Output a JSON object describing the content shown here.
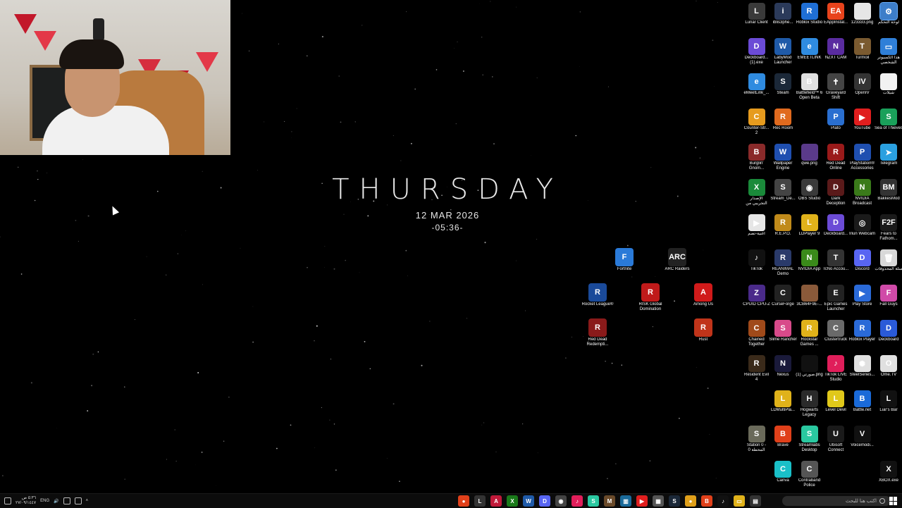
{
  "wallpaper_clock": {
    "day": "THURSDAY",
    "date": "12 MAR 2026",
    "time": "-05:36-"
  },
  "desktop_icons": [
    {
      "label": "Lunar Client",
      "icon": "lunar-client-icon",
      "color": "#3a3a3a",
      "glyph": "L"
    },
    {
      "label": "iblis3phe...",
      "icon": "image-file-icon",
      "color": "#2b3a5a",
      "glyph": "i"
    },
    {
      "label": "Roblox Studio",
      "icon": "roblox-studio-icon",
      "color": "#1f6fd6",
      "glyph": "R"
    },
    {
      "label": "EAppInstal...",
      "icon": "ea-icon",
      "color": "#e8431c",
      "glyph": "EA"
    },
    {
      "label": "123333.png",
      "icon": "image-file-icon",
      "color": "#e6e6e6",
      "glyph": ""
    },
    {
      "label": "لوحة التحكم",
      "icon": "control-panel-icon",
      "color": "#3d7ec9",
      "glyph": "⚙"
    },
    {
      "label": "Deckboard... (1).exe",
      "icon": "deckboard-icon",
      "color": "#6b4bd6",
      "glyph": "D"
    },
    {
      "label": "LabyMod Launcher",
      "icon": "labymod-icon",
      "color": "#1f5aa8",
      "glyph": "W"
    },
    {
      "label": "EMEETLINK",
      "icon": "emeetlink-icon",
      "color": "#2f8be0",
      "glyph": "e"
    },
    {
      "label": "NZXT CAM",
      "icon": "nzxt-icon",
      "color": "#5a2ca0",
      "glyph": "N"
    },
    {
      "label": "Turmoil",
      "icon": "turmoil-icon",
      "color": "#7a5a30",
      "glyph": "T"
    },
    {
      "label": "هذا الكمبيوتر الشخصي",
      "icon": "this-pc-icon",
      "color": "#2f7fd8",
      "glyph": "▭"
    },
    {
      "label": "eMeetLink_...",
      "icon": "emeetlink-icon",
      "color": "#2f8be0",
      "glyph": "e"
    },
    {
      "label": "Steam",
      "icon": "steam-icon",
      "color": "#1b2838",
      "glyph": "S"
    },
    {
      "label": "Battlefield™ 6 Open Beta",
      "icon": "battlefield-icon",
      "color": "#e0e0e0",
      "glyph": "B"
    },
    {
      "label": "Graveyard Shift",
      "icon": "graveyard-shift-icon",
      "color": "#444",
      "glyph": "✝"
    },
    {
      "label": "OpenIV",
      "icon": "openiv-icon",
      "color": "#333",
      "glyph": "IV"
    },
    {
      "label": "شيلات",
      "icon": "text-file-icon",
      "color": "#f2f2f2",
      "glyph": ""
    },
    {
      "label": "Counter-Str... 2",
      "icon": "counter-strike-icon",
      "color": "#e69b1e",
      "glyph": "C"
    },
    {
      "label": "Rec Room",
      "icon": "rec-room-icon",
      "color": "#e06a1e",
      "glyph": "R"
    },
    {
      "label": "",
      "icon": "blank-icon",
      "color": "transparent",
      "glyph": ""
    },
    {
      "label": "Plato",
      "icon": "plato-icon",
      "color": "#2a6fd0",
      "glyph": "P"
    },
    {
      "label": "YouTube",
      "icon": "youtube-icon",
      "color": "#e01e1e",
      "glyph": "▶"
    },
    {
      "label": "Sea of Thieves",
      "icon": "sea-of-thieves-icon",
      "color": "#1aa05a",
      "glyph": "S"
    },
    {
      "label": "Burglin' Gnom...",
      "icon": "burglin-gnomes-icon",
      "color": "#8a2a2a",
      "glyph": "B"
    },
    {
      "label": "Wallpaper Engine",
      "icon": "wallpaper-engine-icon",
      "color": "#1f4fb0",
      "glyph": "W"
    },
    {
      "label": "qwe.png",
      "icon": "image-file-icon",
      "color": "#5a3a8a",
      "glyph": ""
    },
    {
      "label": "Red Dead Online",
      "icon": "red-dead-online-icon",
      "color": "#9a1a1a",
      "glyph": "R"
    },
    {
      "label": "PlayStation® Accessories",
      "icon": "playstation-icon",
      "color": "#1f4fb0",
      "glyph": "P"
    },
    {
      "label": "Telegram",
      "icon": "telegram-icon",
      "color": "#2aa0e0",
      "glyph": "➤"
    },
    {
      "label": "الإصدار التجريبي من",
      "icon": "xbox-preview-icon",
      "color": "#1a8a3a",
      "glyph": "X"
    },
    {
      "label": "Stream_De...",
      "icon": "stream-deck-icon",
      "color": "#444",
      "glyph": "S"
    },
    {
      "label": "OBS Studio",
      "icon": "obs-icon",
      "color": "#3a3a3a",
      "glyph": "◉"
    },
    {
      "label": "Dark Deception",
      "icon": "dark-deception-icon",
      "color": "#5a1a1a",
      "glyph": "D"
    },
    {
      "label": "NVIDIA Broadcast",
      "icon": "nvidia-broadcast-icon",
      "color": "#3a7a1a",
      "glyph": "N"
    },
    {
      "label": "BakkesMod",
      "icon": "bakkesmod-icon",
      "color": "#333",
      "glyph": "BM"
    },
    {
      "label": "اغنية-تصم",
      "icon": "media-file-icon",
      "color": "#e6e6e6",
      "glyph": "▶"
    },
    {
      "label": "R.E.P.O.",
      "icon": "repo-icon",
      "color": "#c08a1a",
      "glyph": "R"
    },
    {
      "label": "LDPlayer 9",
      "icon": "ldplayer-icon",
      "color": "#e0b21a",
      "glyph": "L"
    },
    {
      "label": "Deckboard...",
      "icon": "deckboard-icon",
      "color": "#6b4bd6",
      "glyph": "D"
    },
    {
      "label": "Iriun Webcam",
      "icon": "iriun-webcam-icon",
      "color": "#1a1a1a",
      "glyph": "◎"
    },
    {
      "label": "Fears to Fathom...",
      "icon": "fears-to-fathom-icon",
      "color": "#1a1a1a",
      "glyph": "F2F"
    },
    {
      "label": "TikTok",
      "icon": "tiktok-icon",
      "color": "#111",
      "glyph": "♪"
    },
    {
      "label": "REANIMAL Demo",
      "icon": "reanimal-icon",
      "color": "#2a3a6a",
      "glyph": "R"
    },
    {
      "label": "NVIDIA App",
      "icon": "nvidia-icon",
      "color": "#3a8a1a",
      "glyph": "N"
    },
    {
      "label": "TcNo Accou...",
      "icon": "tcno-icon",
      "color": "#333",
      "glyph": "T"
    },
    {
      "label": "Discord",
      "icon": "discord-icon",
      "color": "#5865f2",
      "glyph": "D"
    },
    {
      "label": "سلة المحذوفات",
      "icon": "recycle-bin-icon",
      "color": "#d8d8d8",
      "glyph": "🗑"
    },
    {
      "label": "CPUID CPU-Z",
      "icon": "cpu-z-icon",
      "color": "#4a2a8a",
      "glyph": "Z"
    },
    {
      "label": "CurseForge",
      "icon": "curseforge-icon",
      "color": "#222",
      "glyph": "C"
    },
    {
      "label": "3CB64F9E-...",
      "icon": "image-file-icon",
      "color": "#8a5a3a",
      "glyph": ""
    },
    {
      "label": "Epic Games Launcher",
      "icon": "epic-games-icon",
      "color": "#222",
      "glyph": "E"
    },
    {
      "label": "Play Store",
      "icon": "play-store-icon",
      "color": "#2a6ad8",
      "glyph": "▶"
    },
    {
      "label": "Fall Guys",
      "icon": "fall-guys-icon",
      "color": "#d04aa8",
      "glyph": "F"
    },
    {
      "label": "Chained Together",
      "icon": "chained-together-icon",
      "color": "#a04a1a",
      "glyph": "C"
    },
    {
      "label": "Slime Rancher",
      "icon": "slime-rancher-icon",
      "color": "#d84a8a",
      "glyph": "S"
    },
    {
      "label": "Rockstar Games ...",
      "icon": "rockstar-icon",
      "color": "#e0b21a",
      "glyph": "R"
    },
    {
      "label": "Clustertruck",
      "icon": "clustertruck-icon",
      "color": "#6a6a6a",
      "glyph": "C"
    },
    {
      "label": "Roblox Player",
      "icon": "roblox-icon",
      "color": "#2a6ad8",
      "glyph": "R"
    },
    {
      "label": "Deckboard",
      "icon": "deckboard-icon",
      "color": "#2a5ad8",
      "glyph": "D"
    },
    {
      "label": "Resident Evil 4",
      "icon": "resident-evil-icon",
      "color": "#3a2a1a",
      "glyph": "R"
    },
    {
      "label": "Nexus",
      "icon": "nexus-icon",
      "color": "#1a1a3a",
      "glyph": "N"
    },
    {
      "label": "صورتي (1).png",
      "icon": "image-file-icon",
      "color": "#111",
      "glyph": ""
    },
    {
      "label": "TikTok LIVE Studio",
      "icon": "tiktok-live-icon",
      "color": "#e01e5a",
      "glyph": "♪"
    },
    {
      "label": "SteelSeries...",
      "icon": "steelseries-icon",
      "color": "#e0e0e0",
      "glyph": "✺"
    },
    {
      "label": "Ome.TV",
      "icon": "ome-tv-icon",
      "color": "#e0e0e0",
      "glyph": "O"
    },
    {
      "label": "",
      "icon": "blank-icon",
      "color": "transparent",
      "glyph": ""
    },
    {
      "label": "LDMultiPla...",
      "icon": "ldmultiplayer-icon",
      "color": "#e0b21a",
      "glyph": "L"
    },
    {
      "label": "Hogwarts Legacy",
      "icon": "hogwarts-legacy-icon",
      "color": "#2a2a2a",
      "glyph": "H"
    },
    {
      "label": "Level Devil",
      "icon": "level-devil-icon",
      "color": "#e0c81a",
      "glyph": "L"
    },
    {
      "label": "Battle.net",
      "icon": "battle-net-icon",
      "color": "#1a6ad8",
      "glyph": "B"
    },
    {
      "label": "Liar's Bar",
      "icon": "liars-bar-icon",
      "color": "#111",
      "glyph": "L"
    },
    {
      "label": "Station 0 - المحطة 0",
      "icon": "station-zero-icon",
      "color": "#6a6a5a",
      "glyph": "S"
    },
    {
      "label": "Brave",
      "icon": "brave-icon",
      "color": "#e0401a",
      "glyph": "B"
    },
    {
      "label": "Streamlabs Desktop",
      "icon": "streamlabs-icon",
      "color": "#2ac8a0",
      "glyph": "S"
    },
    {
      "label": "Ubisoft Connect",
      "icon": "ubisoft-icon",
      "color": "#1a1a1a",
      "glyph": "U"
    },
    {
      "label": "Voicemodi...",
      "icon": "voicemod-icon",
      "color": "#111",
      "glyph": "V"
    },
    {
      "label": "",
      "icon": "blank-icon",
      "color": "transparent",
      "glyph": ""
    },
    {
      "label": "",
      "icon": "blank-icon",
      "color": "transparent",
      "glyph": ""
    },
    {
      "label": "Canva",
      "icon": "canva-icon",
      "color": "#1ac0c8",
      "glyph": "C"
    },
    {
      "label": "Contraband Police",
      "icon": "contraband-police-icon",
      "color": "#555",
      "glyph": "C"
    },
    {
      "label": "",
      "icon": "blank-icon",
      "color": "transparent",
      "glyph": ""
    },
    {
      "label": "",
      "icon": "blank-icon",
      "color": "transparent",
      "glyph": ""
    },
    {
      "label": "XBOX.exe",
      "icon": "xbox-icon",
      "color": "#111",
      "glyph": "X"
    }
  ],
  "free_icons": [
    {
      "label": "Fortnite",
      "icon": "fortnite-icon",
      "color": "#2a7ad8",
      "glyph": "F"
    },
    {
      "label": "ARC Raiders",
      "icon": "arc-raiders-icon",
      "color": "#222",
      "glyph": "ARC"
    },
    {
      "label": "Rocket League®",
      "icon": "rocket-league-icon",
      "color": "#1a4a9a",
      "glyph": "R"
    },
    {
      "label": "RISK Global Domination",
      "icon": "risk-icon",
      "color": "#c01a1a",
      "glyph": "R"
    },
    {
      "label": "Among Us",
      "icon": "among-us-icon",
      "color": "#d01a1a",
      "glyph": "A"
    },
    {
      "label": "Red Dead Redempti...",
      "icon": "red-dead-redemption-icon",
      "color": "#8a1a1a",
      "glyph": "R"
    },
    {
      "label": "Rust",
      "icon": "rust-icon",
      "color": "#c0341a",
      "glyph": "R"
    }
  ],
  "taskbar": {
    "clock_time": "٥:٣٦ ص",
    "clock_date": "٢٧/٠٩/١٤٤٧",
    "language": "ENG",
    "search_placeholder": "اكتب هنا للبحث",
    "apps": [
      {
        "icon": "chrome-icon",
        "color": "#e0401a",
        "glyph": "●"
      },
      {
        "icon": "lunar-client-icon",
        "color": "#333",
        "glyph": "L"
      },
      {
        "icon": "adobe-icon",
        "color": "#c01a3a",
        "glyph": "A"
      },
      {
        "icon": "xbox-icon",
        "color": "#1a7a1a",
        "glyph": "X"
      },
      {
        "icon": "labymod-icon",
        "color": "#1f5aa8",
        "glyph": "W"
      },
      {
        "icon": "discord-icon",
        "color": "#5865f2",
        "glyph": "D"
      },
      {
        "icon": "obs-icon",
        "color": "#444",
        "glyph": "◉"
      },
      {
        "icon": "tiktok-live-icon",
        "color": "#e01e5a",
        "glyph": "♪"
      },
      {
        "icon": "streamlabs-icon",
        "color": "#2ac8a0",
        "glyph": "S"
      },
      {
        "icon": "minecraft-icon",
        "color": "#6a4a2a",
        "glyph": "M"
      },
      {
        "icon": "dashboard-icon",
        "color": "#1a6a9a",
        "glyph": "▥"
      },
      {
        "icon": "youtube-icon",
        "color": "#e01e1e",
        "glyph": "▶"
      },
      {
        "icon": "grid-app-icon",
        "color": "#555",
        "glyph": "▦"
      },
      {
        "icon": "steam-icon",
        "color": "#1b2838",
        "glyph": "S"
      },
      {
        "icon": "chrome-icon",
        "color": "#e0a01a",
        "glyph": "●"
      },
      {
        "icon": "brave-icon",
        "color": "#e0401a",
        "glyph": "B"
      },
      {
        "icon": "tiktok-icon",
        "color": "#111",
        "glyph": "♪"
      },
      {
        "icon": "file-explorer-icon",
        "color": "#e0b21a",
        "glyph": "▭"
      },
      {
        "icon": "task-view-icon",
        "color": "#333",
        "glyph": "▤"
      }
    ]
  }
}
